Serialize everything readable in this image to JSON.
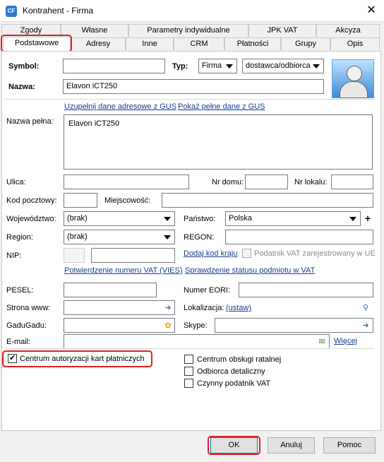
{
  "window": {
    "title": "Kontrahent - Firma",
    "app_icon": "CF",
    "close_glyph": "✕"
  },
  "tabs": {
    "row1": [
      "Zgody",
      "Własne",
      "Parametry indywidualne",
      "JPK VAT",
      "Akcyza"
    ],
    "row2": [
      "Podstawowe",
      "Adresy",
      "Inne",
      "CRM",
      "Płatności",
      "Grupy",
      "Opis"
    ],
    "active": "Podstawowe"
  },
  "form": {
    "symbol_label": "Symbol:",
    "symbol_value": "",
    "typ_label": "Typ:",
    "typ_value": "Firma",
    "role_value": "dostawca/odbiorca",
    "nazwa_label": "Nazwa:",
    "nazwa_value": "Elavon iCT250",
    "gus_link": "Uzupełnij dane adresowe z GUS",
    "gus_show_link": "Pokaż pełne dane z GUS",
    "nazwa_pelna_label": "Nazwa pełna:",
    "nazwa_pelna_value": "Elavon iCT250",
    "ulica_label": "Ulica:",
    "nr_domu_label": "Nr domu:",
    "nr_lokalu_label": "Nr lokalu:",
    "kod_label": "Kod pocztowy:",
    "miejscowosc_label": "Miejscowość:",
    "wojewodztwo_label": "Województwo:",
    "wojewodztwo_value": "(brak)",
    "panstwo_label": "Państwo:",
    "panstwo_value": "Polska",
    "plus": "+",
    "region_label": "Region:",
    "region_value": "(brak)",
    "regon_label": "REGON:",
    "nip_label": "NIP:",
    "dodaj_kod_link": "Dodaj kod kraju",
    "podatnik_ue_label": "Podatnik VAT zarejestrowany w UE",
    "vies_link": "Potwierdzenie numeru VAT (VIES)",
    "status_vat_link": "Sprawdzenie statusu podmiotu w VAT",
    "pesel_label": "PESEL:",
    "eori_label": "Numer EORI:",
    "www_label": "Strona www:",
    "lokalizacja_label": "Lokalizacja:",
    "ustaw_link": "(ustaw)",
    "gadugadu_label": "GaduGadu:",
    "skype_label": "Skype:",
    "email_label": "E-mail:",
    "wiecej_link": "Więcej",
    "cb_centrum_kart": "Centrum autoryzacji kart płatniczych",
    "cb_centrum_ratalnej": "Centrum obsługi ratalnej",
    "cb_odbiorca": "Odbiorca detaliczny",
    "cb_czynny_vat": "Czynny podatnik VAT"
  },
  "buttons": {
    "ok": "OK",
    "cancel": "Anuluj",
    "help": "Pomoc"
  },
  "colors": {
    "highlight": "#e02020",
    "link": "#1a3b8f"
  }
}
